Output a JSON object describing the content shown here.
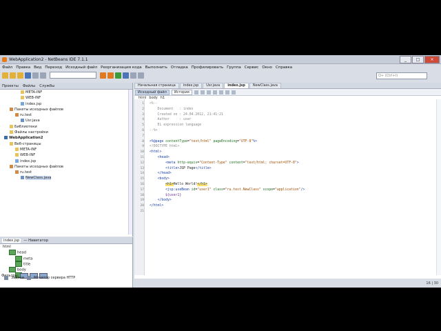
{
  "window": {
    "title": "WebApplication2 - NetBeans IDE 7.1.1",
    "controls": [
      "_",
      "□",
      "×"
    ]
  },
  "menu": [
    "Файл",
    "Правка",
    "Вид",
    "Переход",
    "Исходный файл",
    "Реорганизация кода",
    "Выполнить",
    "Отладка",
    "Профилировать",
    "Группа",
    "Сервис",
    "Окно",
    "Справка"
  ],
  "search": {
    "placeholder": "Q+ (Ctrl+I)"
  },
  "projects_panel": {
    "tabs": [
      "Проекты",
      "Файлы",
      "Службы"
    ],
    "tree": [
      {
        "indent": 3,
        "icon": "folder",
        "label": "META-INF"
      },
      {
        "indent": 3,
        "icon": "folder",
        "label": "WEB-INF"
      },
      {
        "indent": 3,
        "icon": "jsp",
        "label": "index.jsp"
      },
      {
        "indent": 1,
        "icon": "package",
        "label": "Пакеты исходных файлов"
      },
      {
        "indent": 2,
        "icon": "package",
        "label": "ru.test"
      },
      {
        "indent": 3,
        "icon": "java",
        "label": "Usr.java"
      },
      {
        "indent": 1,
        "icon": "folder",
        "label": "Библиотеки"
      },
      {
        "indent": 1,
        "icon": "folder",
        "label": "Файлы настройки"
      },
      {
        "indent": 0,
        "icon": "project",
        "label": "WebApplication2",
        "bold": true
      },
      {
        "indent": 1,
        "icon": "folder",
        "label": "Веб-страницы"
      },
      {
        "indent": 2,
        "icon": "folder",
        "label": "META-INF"
      },
      {
        "indent": 2,
        "icon": "folder",
        "label": "WEB-INF"
      },
      {
        "indent": 2,
        "icon": "jsp",
        "label": "index.jsp"
      },
      {
        "indent": 1,
        "icon": "package",
        "label": "Пакеты исходных файлов"
      },
      {
        "indent": 2,
        "icon": "package",
        "label": "ru.test"
      },
      {
        "indent": 3,
        "icon": "java",
        "label": "NewClass.java",
        "selected": true
      }
    ]
  },
  "navigator": {
    "tabs": [
      "index.jsp",
      "— Навигатор"
    ],
    "tree": [
      {
        "indent": 0,
        "tag": false,
        "label": "html"
      },
      {
        "indent": 1,
        "tag": true,
        "label": "head"
      },
      {
        "indent": 2,
        "tag": true,
        "label": "meta"
      },
      {
        "indent": 2,
        "tag": true,
        "label": "title"
      },
      {
        "indent": 1,
        "tag": true,
        "label": "body"
      },
      {
        "indent": 2,
        "tag": true,
        "label": "h1"
      }
    ],
    "filters_label": "Фильтры:"
  },
  "editor": {
    "tabs": [
      "Начальная страница",
      "index.jsp",
      "Usr.java",
      "index.jsp",
      "NewClass.java"
    ],
    "active_tab": 3,
    "subtabs": [
      "Исходный файл",
      "История"
    ],
    "breadcrumbs": [
      "html",
      "body",
      "h1"
    ],
    "lines": [
      {
        "n": "1",
        "html": "<span class='cm'>&lt;%--</span>"
      },
      {
        "n": "2",
        "html": "<span class='cm'>    Document   : index</span>"
      },
      {
        "n": "3",
        "html": "<span class='cm'>    Created on : 24.04.2012, 21:41:21</span>"
      },
      {
        "n": "4",
        "html": "<span class='cm'>    Author     : user</span>"
      },
      {
        "n": "5",
        "html": "<span class='cm'>    EL expression language</span>"
      },
      {
        "n": "6",
        "html": "<span class='cm'>--%&gt;</span>"
      },
      {
        "n": "7",
        "html": ""
      },
      {
        "n": "8",
        "html": "<span class='tg'>&lt;%@page</span> <span class='at'>contentType</span>=<span class='st'>\"text/html\"</span> <span class='at'>pageEncoding</span>=<span class='st'>\"UTF-8\"</span><span class='tg'>%&gt;</span>"
      },
      {
        "n": "9",
        "html": "<span class='cm'>&lt;!DOCTYPE html&gt;</span>"
      },
      {
        "n": "10",
        "html": "<span class='tg'>&lt;html&gt;</span>"
      },
      {
        "n": "11",
        "html": "    <span class='tg'>&lt;head&gt;</span>"
      },
      {
        "n": "12",
        "html": "        <span class='tg'>&lt;meta</span> <span class='at'>http-equiv</span>=<span class='st'>\"Content-Type\"</span> <span class='at'>content</span>=<span class='st'>\"text/html; charset=UTF-8\"</span><span class='tg'>&gt;</span>"
      },
      {
        "n": "13",
        "html": "        <span class='tg'>&lt;title&gt;</span>JSP Page<span class='tg'>&lt;/title&gt;</span>"
      },
      {
        "n": "14",
        "html": "    <span class='tg'>&lt;/head&gt;</span>"
      },
      {
        "n": "15",
        "html": "    <span class='tg'>&lt;body&gt;</span>"
      },
      {
        "n": "16",
        "html": "        <span class='tg hl'>&lt;h1&gt;</span>Hello World!<span class='tg hl'>&lt;/h1&gt;</span>"
      },
      {
        "n": "17",
        "html": "        <span class='tg'>&lt;jsp:useBean</span> <span class='at'>id</span>=<span class='st'>\"user1\"</span> <span class='at'>class</span>=<span class='st'>\"ru.test.NewClass\"</span> <span class='at'>scope</span>=<span class='st'>\"application\"</span><span class='tg'>/&gt;</span>"
      },
      {
        "n": "18",
        "html": "        <span class='el'>${user1}</span>"
      },
      {
        "n": "19",
        "html": "    <span class='tg'>&lt;/body&gt;</span>"
      },
      {
        "n": "20",
        "html": "<span class='tg'>&lt;/html&gt;</span>"
      },
      {
        "n": "21",
        "html": ""
      }
    ]
  },
  "status": {
    "items": [
      "Задачи",
      "Монитор сервера HTTP"
    ],
    "position": "16 | 30"
  }
}
